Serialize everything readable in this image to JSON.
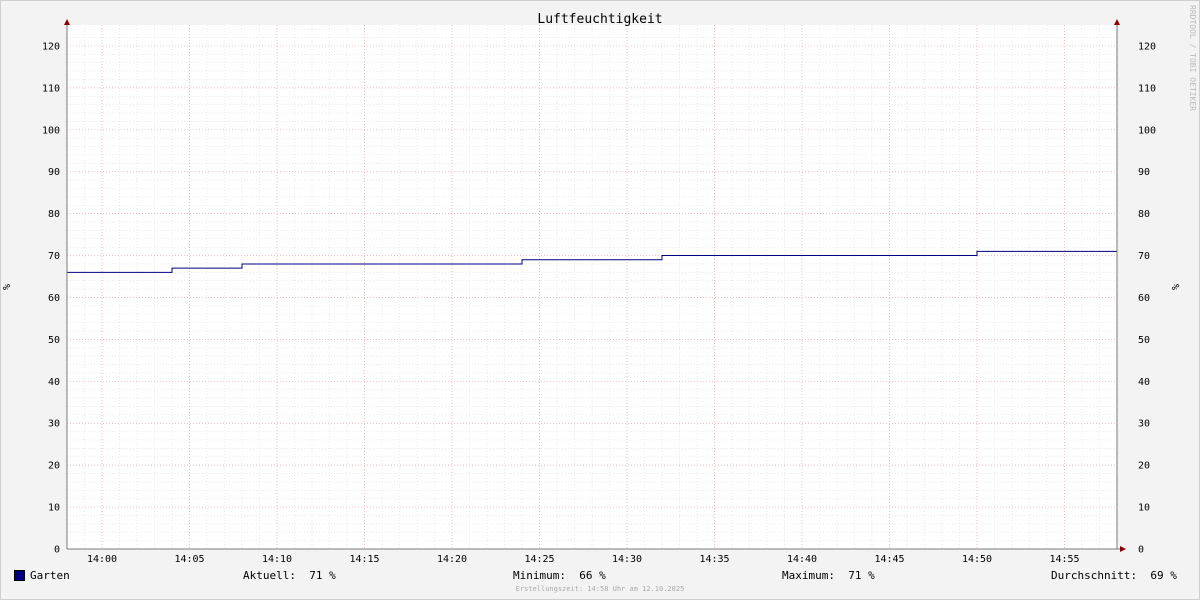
{
  "chart_data": {
    "type": "line",
    "title": "Luftfeuchtigkeit",
    "ylabel": "%",
    "ylim": [
      0,
      125
    ],
    "y_ticks": [
      0,
      10,
      20,
      30,
      40,
      50,
      60,
      70,
      80,
      90,
      100,
      110,
      120
    ],
    "x_ticks": [
      "14:00",
      "14:05",
      "14:10",
      "14:15",
      "14:20",
      "14:25",
      "14:30",
      "14:35",
      "14:40",
      "14:45",
      "14:50",
      "14:55"
    ],
    "xlim": [
      "13:58",
      "14:58"
    ],
    "grid": true,
    "series": [
      {
        "name": "Garten",
        "color": "#000080",
        "points": [
          {
            "t": "13:58",
            "v": 66
          },
          {
            "t": "14:04",
            "v": 67
          },
          {
            "t": "14:08",
            "v": 68
          },
          {
            "t": "14:24",
            "v": 69
          },
          {
            "t": "14:32",
            "v": 70
          },
          {
            "t": "14:50",
            "v": 71
          },
          {
            "t": "14:58",
            "v": 71
          }
        ]
      }
    ]
  },
  "watermark": "RRDTOOL / TOBI OETIKER",
  "legend": {
    "series_name": "Garten",
    "swatch_color": "#000080",
    "aktuell": "Aktuell:  71 %",
    "minimum": "Minimum:  66 %",
    "maximum": "Maximum:  71 %",
    "durchschnitt": "Durchschnitt:  69 %"
  },
  "footer": "Erstellungszeit: 14:58 Uhr am 12.10.2025"
}
